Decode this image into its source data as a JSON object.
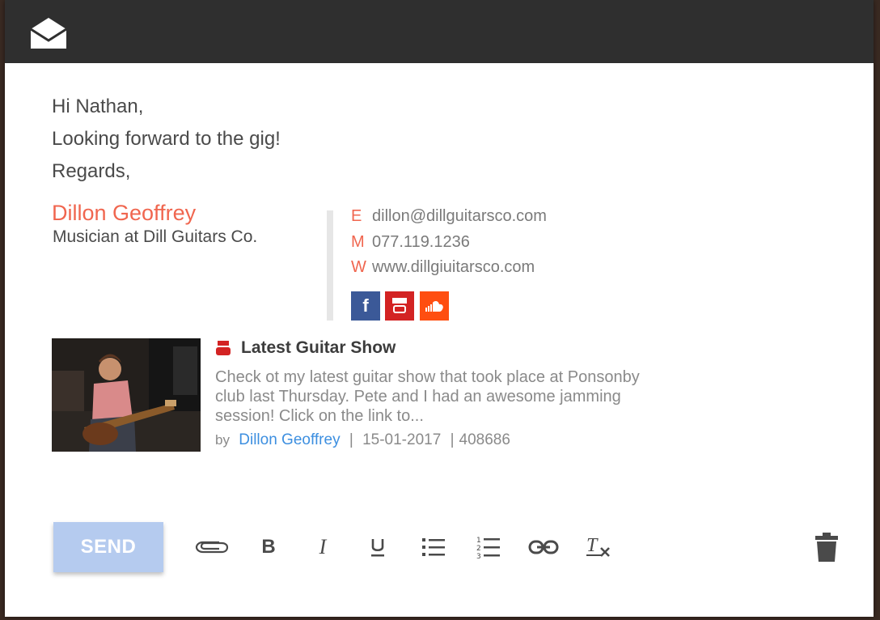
{
  "email": {
    "greeting": "Hi Nathan,",
    "line1": "Looking forward to the gig!",
    "closing": "Regards,"
  },
  "signature": {
    "name": "Dillon Geoffrey",
    "title": "Musician at Dill Guitars Co.",
    "contacts": [
      {
        "key": "E",
        "value": "dillon@dillguitarsco.com"
      },
      {
        "key": "M",
        "value": "077.119.1236"
      },
      {
        "key": "W",
        "value": "www.dillgiuitarsco.com"
      }
    ],
    "social": [
      {
        "icon": "facebook-icon",
        "color": "#3b5998"
      },
      {
        "icon": "youtube-icon",
        "color": "#d32323"
      },
      {
        "icon": "soundcloud-icon",
        "color": "#ff4e10"
      }
    ]
  },
  "video": {
    "title": "Latest Guitar Show",
    "description": "Check ot my latest guitar show that took place at Ponsonby club last Thursday. Pete and I had an awesome jamming session! Click on the link to...",
    "by_label": "by",
    "author": "Dillon Geoffrey",
    "date": "15-01-2017",
    "views": "408686"
  },
  "toolbar": {
    "send_label": "SEND",
    "tools": [
      "attach-icon",
      "bold-icon",
      "italic-icon",
      "underline-icon",
      "bulleted-list-icon",
      "numbered-list-icon",
      "link-icon",
      "clear-formatting-icon",
      "trash-icon"
    ]
  },
  "colors": {
    "accent": "#f0664f",
    "link": "#3d8fe0",
    "send_disabled": "#b5cbef",
    "header": "#2f2f2f"
  }
}
